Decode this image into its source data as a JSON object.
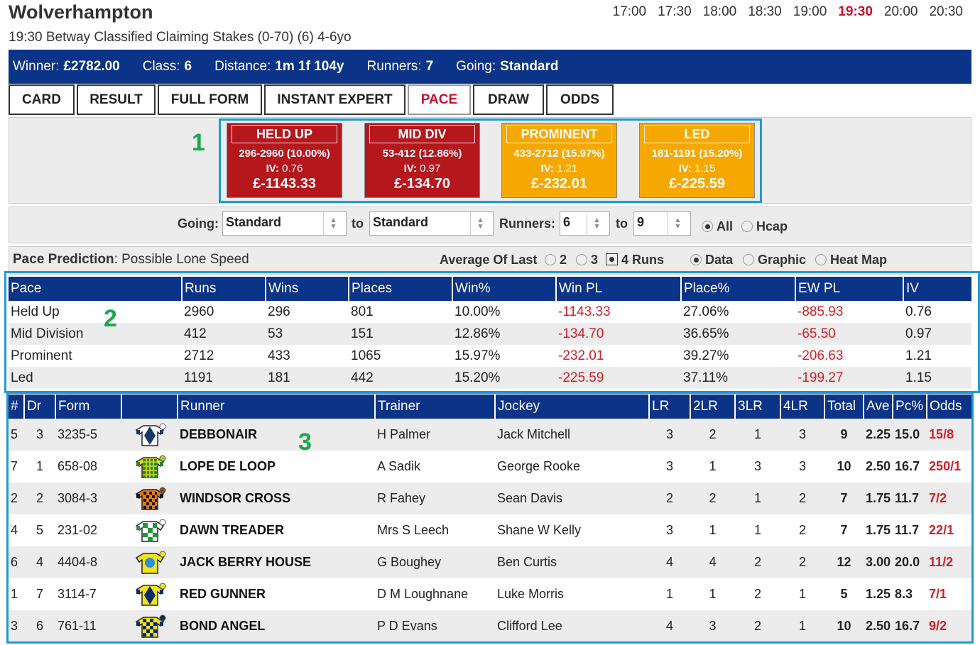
{
  "header": {
    "course": "Wolverhampton",
    "times": [
      "17:00",
      "17:30",
      "18:00",
      "18:30",
      "19:00",
      "19:30",
      "20:00",
      "20:30"
    ],
    "active_time": "19:30",
    "race_title": "19:30 Betway Classified Claiming Stakes (0-70) (6) 4-6yo"
  },
  "infobar": {
    "winner_label": "Winner:",
    "winner_value": "£2782.00",
    "class_label": "Class:",
    "class_value": "6",
    "distance_label": "Distance:",
    "distance_value": "1m 1f 104y",
    "runners_label": "Runners:",
    "runners_value": "7",
    "going_label": "Going:",
    "going_value": "Standard"
  },
  "tabs": [
    "CARD",
    "RESULT",
    "FULL FORM",
    "INSTANT EXPERT",
    "PACE",
    "DRAW",
    "ODDS"
  ],
  "active_tab": "PACE",
  "markers": [
    "1",
    "2",
    "3"
  ],
  "pace_boxes": [
    {
      "title": "HELD UP",
      "line": "296-2960 (10.00%)",
      "iv_label": "IV:",
      "iv": "0.76",
      "pl": "£-1143.33",
      "color": "#b5171d"
    },
    {
      "title": "MID DIV",
      "line": "53-412 (12.86%)",
      "iv_label": "IV:",
      "iv": "0.97",
      "pl": "£-134.70",
      "color": "#b5171d"
    },
    {
      "title": "PROMINENT",
      "line": "433-2712 (15.97%)",
      "iv_label": "IV:",
      "iv": "1.21",
      "pl": "£-232.01",
      "color": "#f7a800"
    },
    {
      "title": "LED",
      "line": "181-1191 (15.20%)",
      "iv_label": "IV:",
      "iv": "1.15",
      "pl": "£-225.59",
      "color": "#f7a800"
    }
  ],
  "filters": {
    "going_label": "Going:",
    "going_from": "Standard",
    "to_label": "to",
    "going_to": "Standard",
    "runners_label": "Runners:",
    "runners_from": "6",
    "runners_to": "9",
    "all_label": "All",
    "hcap_label": "Hcap"
  },
  "prediction": {
    "label": "Pace Prediction",
    "value": ": Possible Lone Speed",
    "avg_label": "Average Of Last",
    "opt2": "2",
    "opt3": "3",
    "opt4": "4 Runs",
    "data_label": "Data",
    "graphic_label": "Graphic",
    "heatmap_label": "Heat Map"
  },
  "pace_table": {
    "headers": [
      "Pace",
      "Runs",
      "Wins",
      "Places",
      "Win%",
      "Win PL",
      "Place%",
      "EW PL",
      "IV"
    ],
    "rows": [
      [
        "Held Up",
        "2960",
        "296",
        "801",
        "10.00%",
        "-1143.33",
        "27.06%",
        "-885.93",
        "0.76"
      ],
      [
        "Mid Division",
        "412",
        "53",
        "151",
        "12.86%",
        "-134.70",
        "36.65%",
        "-65.50",
        "0.97"
      ],
      [
        "Prominent",
        "2712",
        "433",
        "1065",
        "15.97%",
        "-232.01",
        "39.27%",
        "-206.63",
        "1.21"
      ],
      [
        "Led",
        "1191",
        "181",
        "442",
        "15.20%",
        "-225.59",
        "37.11%",
        "-199.27",
        "1.15"
      ]
    ]
  },
  "runners_table": {
    "headers": [
      "#",
      "Dr",
      "Form",
      "",
      "Runner",
      "Trainer",
      "Jockey",
      "LR",
      "2LR",
      "3LR",
      "4LR",
      "Total",
      "Ave",
      "Pc%",
      "Odds"
    ],
    "rows": [
      {
        "num": "5",
        "dr": "3",
        "form": "3235-5",
        "runner": "DEBBONAIR",
        "trainer": "H Palmer",
        "jockey": "Jack Mitchell",
        "lr": "3",
        "lr2": "2",
        "lr3": "1",
        "lr4": "3",
        "total": "9",
        "ave": "2.25",
        "pc": "15.0",
        "odds": "15/8",
        "silk": "debbonair-silk"
      },
      {
        "num": "7",
        "dr": "1",
        "form": "658-08",
        "runner": "LOPE DE LOOP",
        "trainer": "A Sadik",
        "jockey": "George Rooke",
        "lr": "3",
        "lr2": "1",
        "lr3": "3",
        "lr4": "3",
        "total": "10",
        "ave": "2.50",
        "pc": "16.7",
        "odds": "250/1",
        "silk": "lope-de-loop-silk"
      },
      {
        "num": "2",
        "dr": "2",
        "form": "3084-3",
        "runner": "WINDSOR CROSS",
        "trainer": "R Fahey",
        "jockey": "Sean Davis",
        "lr": "2",
        "lr2": "2",
        "lr3": "1",
        "lr4": "2",
        "total": "7",
        "ave": "1.75",
        "pc": "11.7",
        "odds": "7/2",
        "silk": "windsor-cross-silk"
      },
      {
        "num": "4",
        "dr": "5",
        "form": "231-02",
        "runner": "DAWN TREADER",
        "trainer": "Mrs S Leech",
        "jockey": "Shane W Kelly",
        "lr": "3",
        "lr2": "1",
        "lr3": "1",
        "lr4": "2",
        "total": "7",
        "ave": "1.75",
        "pc": "11.7",
        "odds": "22/1",
        "silk": "dawn-treader-silk"
      },
      {
        "num": "6",
        "dr": "4",
        "form": "4404-8",
        "runner": "JACK BERRY HOUSE",
        "trainer": "G Boughey",
        "jockey": "Ben Curtis",
        "lr": "4",
        "lr2": "4",
        "lr3": "2",
        "lr4": "2",
        "total": "12",
        "ave": "3.00",
        "pc": "20.0",
        "odds": "11/2",
        "silk": "jack-berry-house-silk"
      },
      {
        "num": "1",
        "dr": "7",
        "form": "3114-7",
        "runner": "RED GUNNER",
        "trainer": "D M Loughnane",
        "jockey": "Luke Morris",
        "lr": "1",
        "lr2": "1",
        "lr3": "2",
        "lr4": "1",
        "total": "5",
        "ave": "1.25",
        "pc": "8.3",
        "odds": "7/1",
        "silk": "red-gunner-silk"
      },
      {
        "num": "3",
        "dr": "6",
        "form": "761-11",
        "runner": "BOND ANGEL",
        "trainer": "P D Evans",
        "jockey": "Clifford Lee",
        "lr": "4",
        "lr2": "3",
        "lr3": "2",
        "lr4": "1",
        "total": "10",
        "ave": "2.50",
        "pc": "16.7",
        "odds": "9/2",
        "silk": "bond-angel-silk"
      }
    ]
  }
}
